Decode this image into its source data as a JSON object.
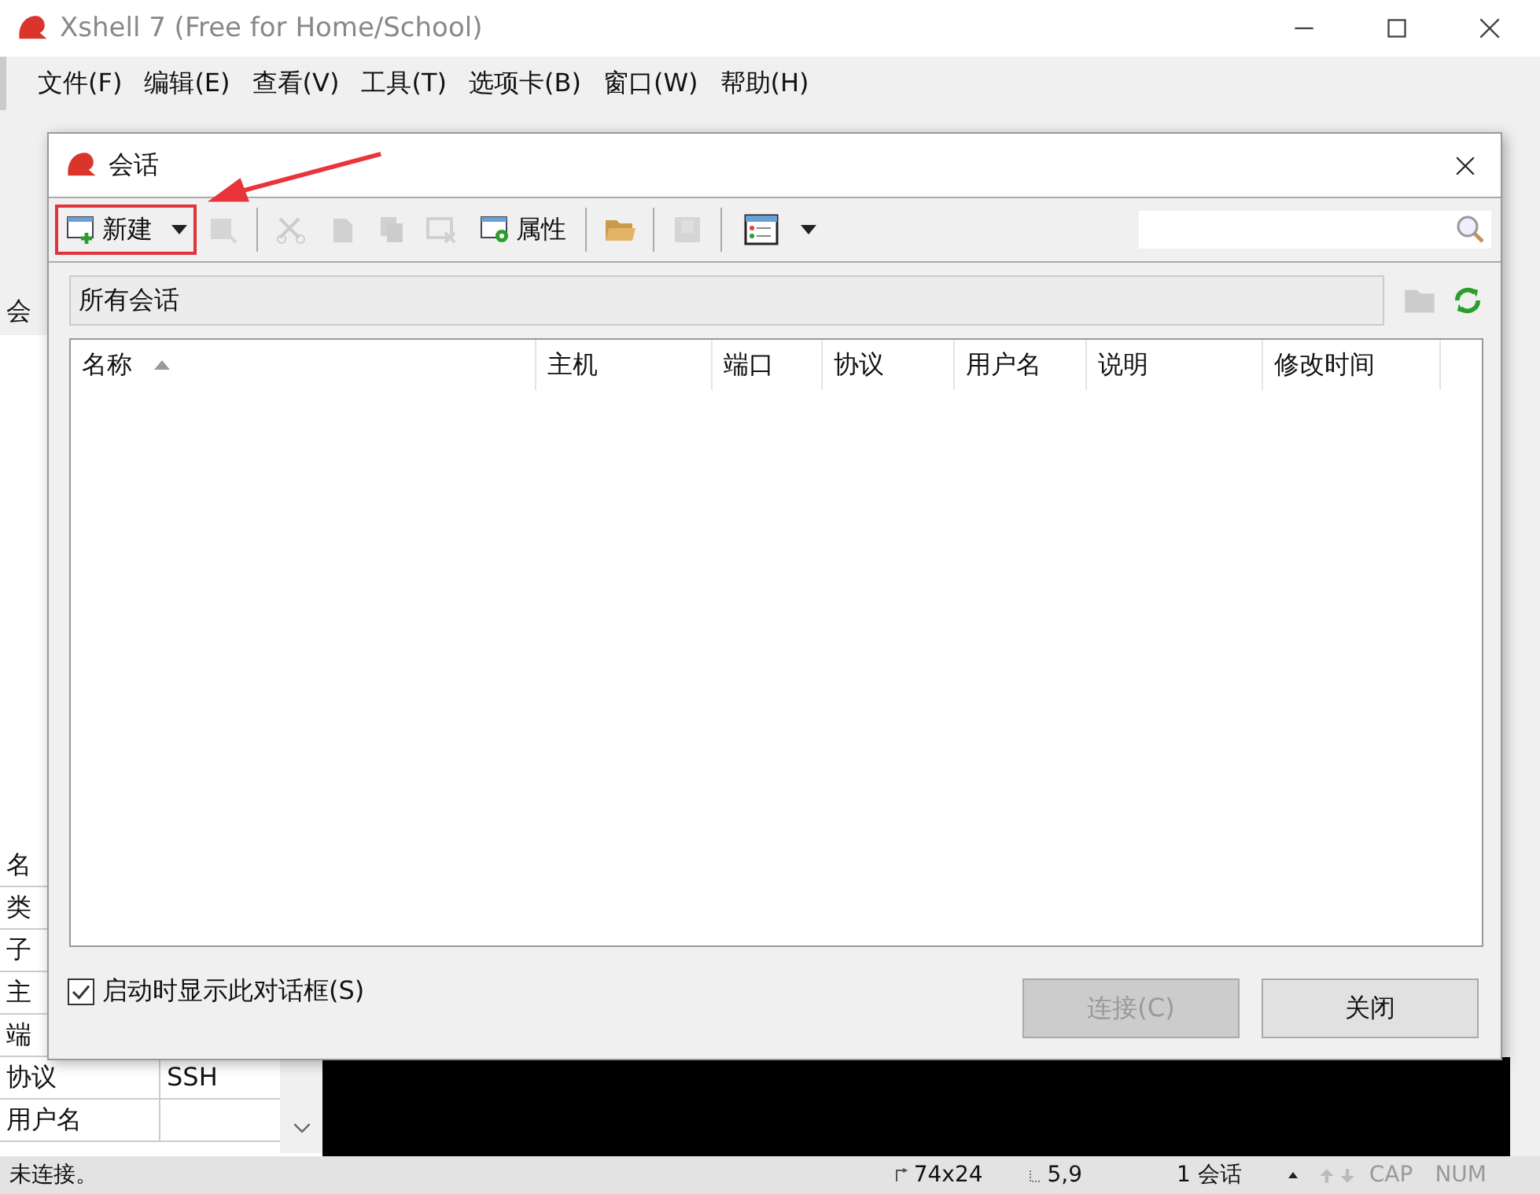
{
  "main_window": {
    "title": "Xshell 7 (Free for Home/School)"
  },
  "menu": [
    {
      "label": "文件(F)"
    },
    {
      "label": "编辑(E)"
    },
    {
      "label": "查看(V)"
    },
    {
      "label": "工具(T)"
    },
    {
      "label": "选项卡(B)"
    },
    {
      "label": "窗口(W)"
    },
    {
      "label": "帮助(H)"
    }
  ],
  "sidebar": {
    "tab_label": "会",
    "properties": [
      {
        "name": "名"
      },
      {
        "name": "类"
      },
      {
        "name": "子"
      },
      {
        "name": "主"
      },
      {
        "name": "端"
      },
      {
        "name": "协议",
        "value": "SSH"
      },
      {
        "name": "用户名"
      }
    ]
  },
  "dialog": {
    "title": "会话",
    "toolbar": [
      {
        "kind": "new",
        "label": "新建",
        "disabled": false,
        "highlighted": true
      },
      {
        "kind": "find",
        "disabled": true
      },
      {
        "kind": "separator"
      },
      {
        "kind": "cut",
        "disabled": true
      },
      {
        "kind": "copy",
        "disabled": true
      },
      {
        "kind": "paste",
        "disabled": true
      },
      {
        "kind": "delete",
        "disabled": true
      },
      {
        "kind": "properties",
        "label": "属性",
        "disabled": false
      },
      {
        "kind": "separator"
      },
      {
        "kind": "folder",
        "disabled": false
      },
      {
        "kind": "separator"
      },
      {
        "kind": "export",
        "disabled": true
      },
      {
        "kind": "separator"
      },
      {
        "kind": "view",
        "disabled": false
      }
    ],
    "path": "所有会话",
    "columns": [
      {
        "label": "名称",
        "sorted": true
      },
      {
        "label": "主机",
        "sorted": false
      },
      {
        "label": "端口",
        "sorted": false
      },
      {
        "label": "协议",
        "sorted": false
      },
      {
        "label": "用户名",
        "sorted": false
      },
      {
        "label": "说明",
        "sorted": false
      },
      {
        "label": "修改时间",
        "sorted": false
      }
    ],
    "show_on_startup": {
      "label": "启动时显示此对话框(S)",
      "checked": true
    },
    "buttons": [
      {
        "label": "连接(C)",
        "disabled": true
      },
      {
        "label": "关闭",
        "disabled": false
      }
    ]
  },
  "status_bar": {
    "message": "未连接。",
    "size": "74x24",
    "cursor": "5,9",
    "sessions": "1 会话",
    "cap": "CAP",
    "num": "NUM"
  }
}
